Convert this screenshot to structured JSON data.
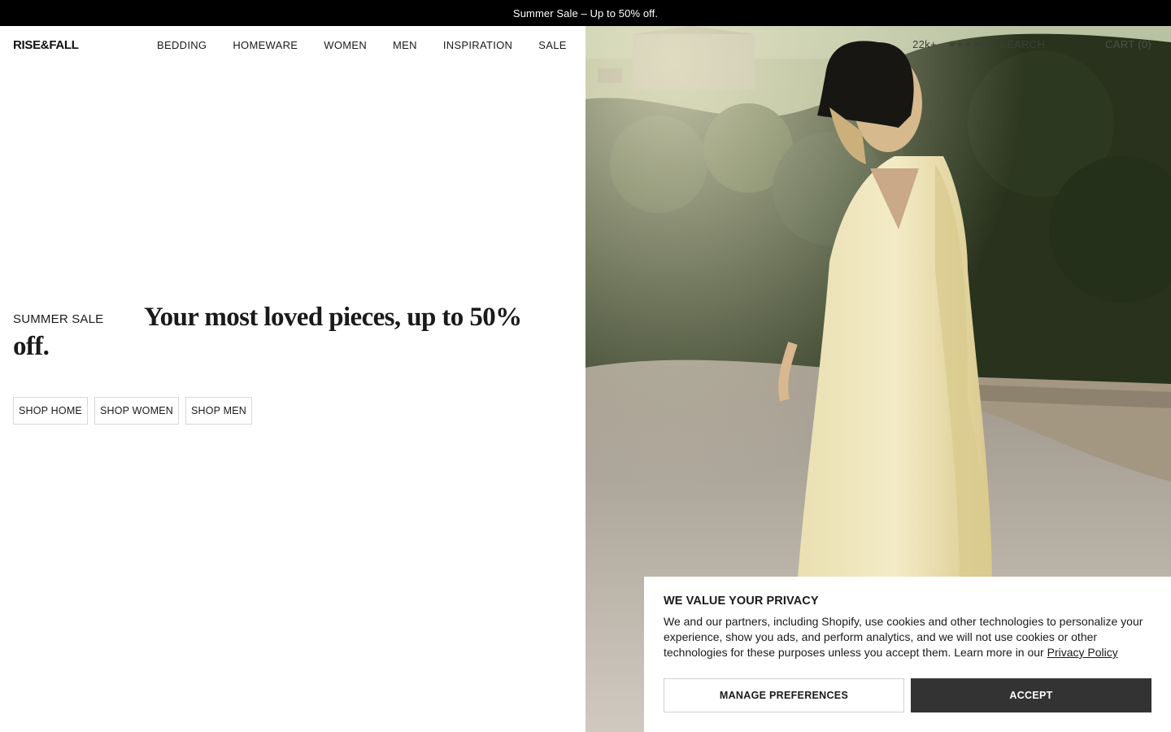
{
  "announcement": {
    "text": "Summer Sale – Up to 50% off."
  },
  "header": {
    "logo": "RISE&FALL",
    "nav": [
      "BEDDING",
      "HOMEWARE",
      "WOMEN",
      "MEN",
      "INSPIRATION",
      "SALE"
    ],
    "reviews_count": "22k+",
    "stars": "★★★★★",
    "search_label": "SEARCH",
    "cart_label": "CART (0)"
  },
  "hero": {
    "kicker": "SUMMER SALE",
    "headline": "Your most loved pieces, up to 50% off.",
    "ctas": [
      "SHOP HOME",
      "SHOP WOMEN",
      "SHOP MEN"
    ]
  },
  "cookie_banner": {
    "title": "WE VALUE YOUR PRIVACY",
    "body": "We and our partners, including Shopify, use cookies and other technologies to personalize your experience, show you ads, and perform analytics, and we will not use cookies or other technologies for these purposes unless you accept them. Learn more in our ",
    "policy_link": "Privacy Policy",
    "manage_label": "MANAGE PREFERENCES",
    "accept_label": "ACCEPT"
  },
  "colors": {
    "announcement_bg": "#000000",
    "accept_bg": "#333333",
    "text": "#1a1a1a"
  }
}
